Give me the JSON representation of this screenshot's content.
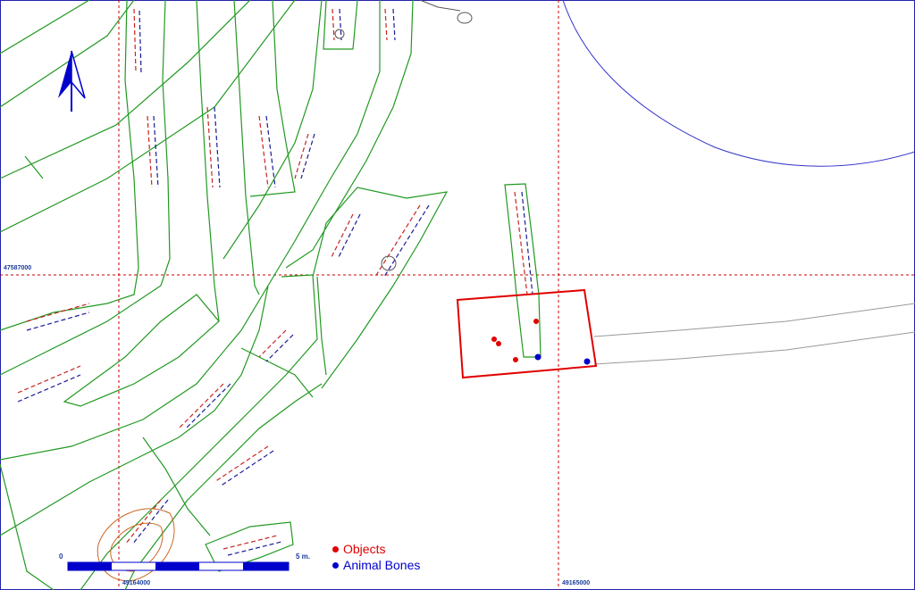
{
  "map": {
    "coordinates": {
      "y_grid_label": "47587000",
      "x_grid_label_1": "49164000",
      "x_grid_label_2": "49165000"
    },
    "scale": {
      "start_label": "0",
      "end_label": "5 m."
    },
    "legend": [
      {
        "label": "Objects",
        "color": "#e00000"
      },
      {
        "label": "Animal Bones",
        "color": "#0000cc"
      }
    ],
    "colors": {
      "grid": "#cc0000",
      "features": "#229922",
      "excavation_box": "#e00000",
      "contour": "#3333cc",
      "north_arrow": "#0000cc",
      "profile_lines": "#999999"
    },
    "icons": [
      "north-arrow-icon",
      "object-point-icon",
      "animal-bone-point-icon"
    ]
  }
}
